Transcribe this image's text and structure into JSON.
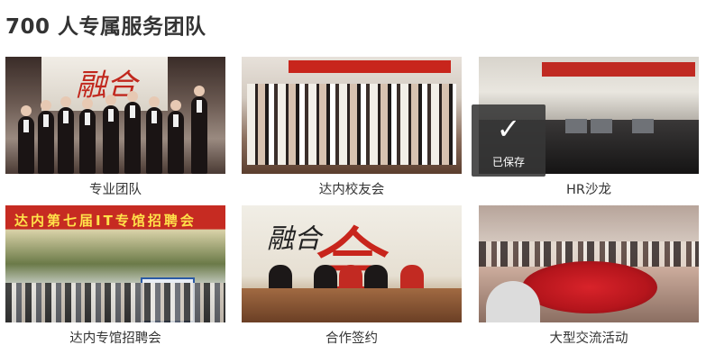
{
  "section": {
    "title": "700 人专属服务团队"
  },
  "cards": [
    {
      "caption": "专业团队",
      "photo_text": "融合"
    },
    {
      "caption": "达内校友会",
      "photo_text": ""
    },
    {
      "caption": "HR沙龙",
      "photo_text": ""
    },
    {
      "caption": "达内专馆招聘会",
      "photo_text": "达内第七届IT专馆招聘会"
    },
    {
      "caption": "合作签约",
      "photo_text": "融合"
    },
    {
      "caption": "大型交流活动",
      "photo_text": ""
    }
  ],
  "saved_overlay": {
    "label": "已保存",
    "icon": "check-icon"
  }
}
